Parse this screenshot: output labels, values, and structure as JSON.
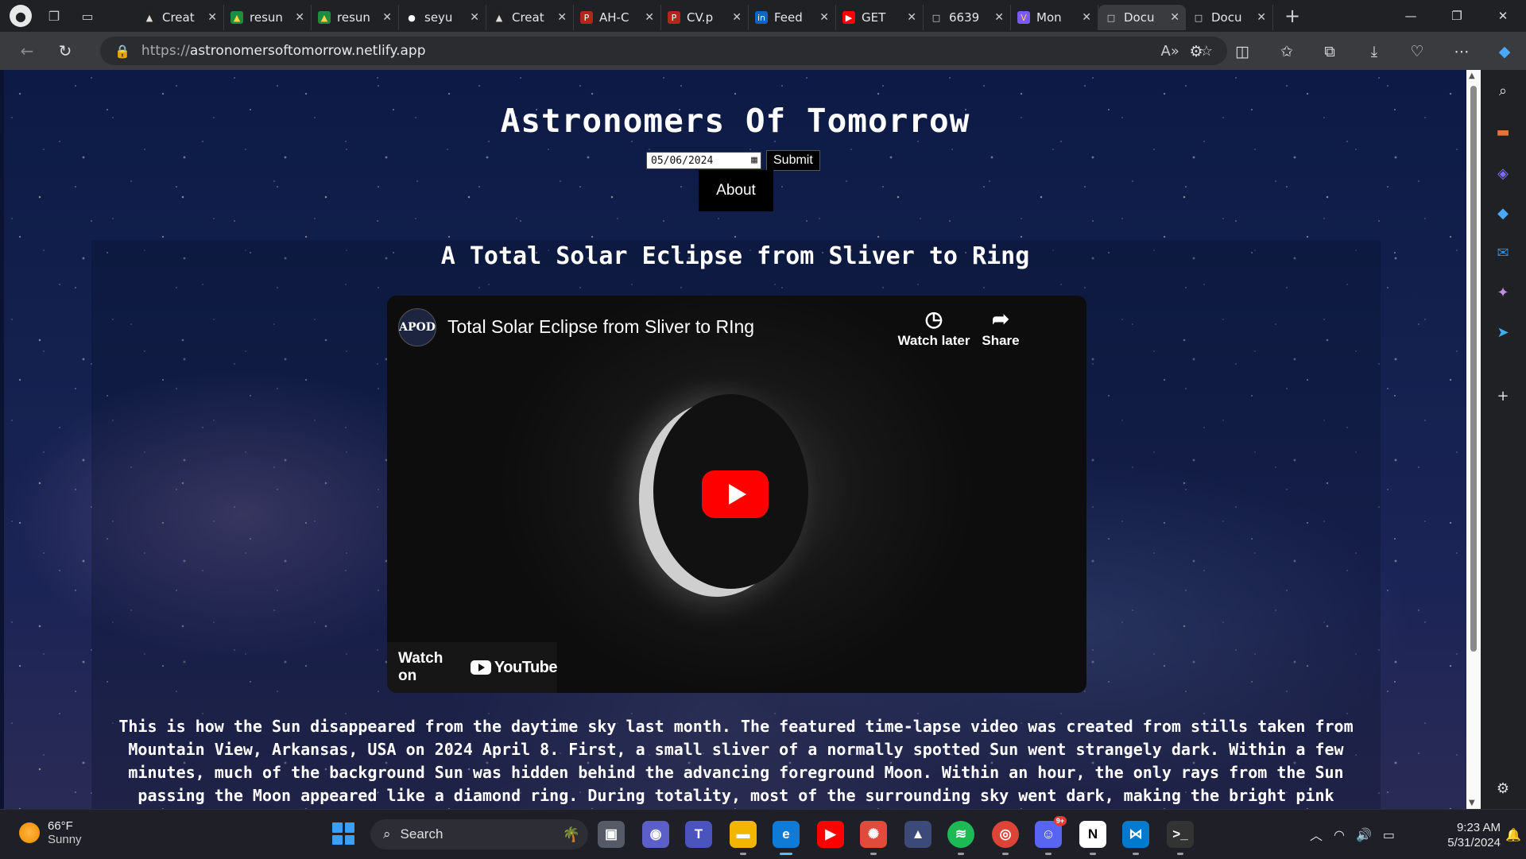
{
  "browser": {
    "tabs": [
      {
        "label": "Creat",
        "fav": "▲",
        "fav_bg": "#222",
        "fav_color": "#ddd"
      },
      {
        "label": "resun",
        "fav": "▲",
        "fav_bg": "#1e8e3e",
        "fav_color": "#ffd04b"
      },
      {
        "label": "resun",
        "fav": "▲",
        "fav_bg": "#1e8e3e",
        "fav_color": "#ffd04b"
      },
      {
        "label": "seyu",
        "fav": "●",
        "fav_bg": "#202124",
        "fav_color": "#fff"
      },
      {
        "label": "Creat",
        "fav": "▲",
        "fav_bg": "#222",
        "fav_color": "#ddd"
      },
      {
        "label": "AH-C",
        "fav": "P",
        "fav_bg": "#b3261e",
        "fav_color": "#fff"
      },
      {
        "label": "CV.p",
        "fav": "P",
        "fav_bg": "#b3261e",
        "fav_color": "#fff"
      },
      {
        "label": "Feed",
        "fav": "in",
        "fav_bg": "#0a66c2",
        "fav_color": "#fff"
      },
      {
        "label": "GET",
        "fav": "▶",
        "fav_bg": "#ff0000",
        "fav_color": "#fff"
      },
      {
        "label": "6639",
        "fav": "□",
        "fav_bg": "transparent",
        "fav_color": "#ddd"
      },
      {
        "label": "Mon",
        "fav": "V",
        "fav_bg": "#7a5af8",
        "fav_color": "#ffd04b"
      },
      {
        "label": "Docu",
        "fav": "□",
        "fav_bg": "transparent",
        "fav_color": "#ddd",
        "active": true
      },
      {
        "label": "Docu",
        "fav": "□",
        "fav_bg": "transparent",
        "fav_color": "#ddd"
      }
    ],
    "url_proto": "https://",
    "url_host": "astronomersoftomorrow.netlify.app"
  },
  "page": {
    "site_title": "Astronomers Of Tomorrow",
    "date_value": "05/06/2024",
    "submit_label": "Submit",
    "about_label": "About",
    "article_title": "A Total Solar Eclipse from Sliver to Ring",
    "video": {
      "channel_logo": "APOD",
      "title": "Total Solar Eclipse from Sliver to RIng",
      "watch_later": "Watch later",
      "share": "Share",
      "watch_on": "Watch on",
      "youtube": "YouTube"
    },
    "explanation": "This is how the Sun disappeared from the daytime sky last month. The featured time-lapse video was created from stills taken from Mountain View, Arkansas, USA on 2024 April 8. First, a small sliver of a normally spotted Sun went strangely dark. Within a few minutes, much of the background Sun was hidden behind the advancing foreground Moon. Within an hour, the only rays from the Sun passing the Moon appeared like a diamond ring. During totality, most of the surrounding sky went dark, making the bright pink"
  },
  "taskbar": {
    "weather_temp": "66°F",
    "weather_desc": "Sunny",
    "search_placeholder": "Search",
    "time": "9:23 AM",
    "date": "5/31/2024",
    "discord_badge": "9+"
  }
}
